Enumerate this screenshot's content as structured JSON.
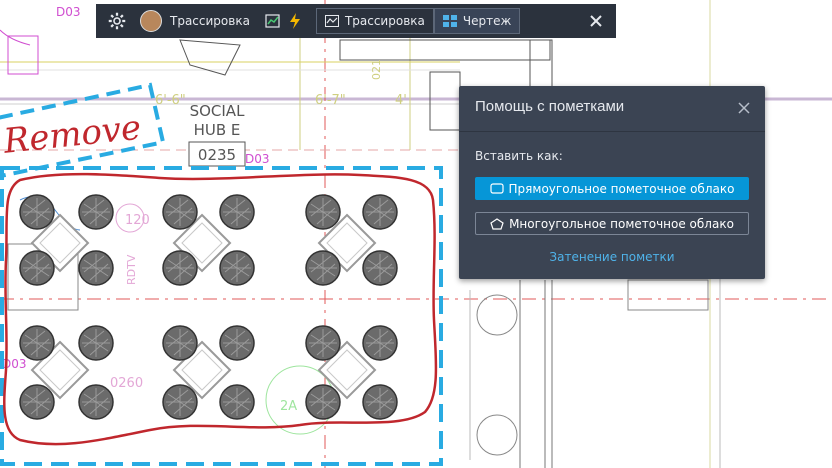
{
  "toolbar": {
    "user_name": "Трассировка",
    "tab_trace": "Трассировка",
    "tab_drawing": "Чертеж"
  },
  "drawing": {
    "room_name_1": "SOCIAL",
    "room_name_2": "HUB E",
    "room_number": "0235",
    "markup_word": "Remove",
    "dim_1": "6'-6\"",
    "dim_2": "6'-7\"",
    "dim_3": "4'",
    "label_d03_top": "D03",
    "label_d03_mid": "D03",
    "label_d03_left": "D03",
    "label_120": "120",
    "label_0260": "0260",
    "label_2a": "2A",
    "label_021": "021",
    "label_rdtv": "RDTV"
  },
  "panel": {
    "title": "Помощь с пометками",
    "insert_as": "Вставить как:",
    "rect_cloud": "Прямоугольное пометочное облако",
    "poly_cloud": "Многоугольное пометочное облако",
    "shade_link": "Затенение пометки"
  },
  "colors": {
    "toolbar_bg": "#2b323d",
    "panel_bg": "#3b4453",
    "accent": "#0696d7",
    "link": "#4fb3ea",
    "markup_red": "#c0272d",
    "markup_blue": "#29abe2"
  },
  "icons": [
    "gear-icon",
    "avatar",
    "markup-chart-icon",
    "lightning-icon",
    "trace-tab-icon",
    "drawing-grid-icon",
    "close-icon",
    "rect-cloud-icon",
    "poly-cloud-icon"
  ]
}
